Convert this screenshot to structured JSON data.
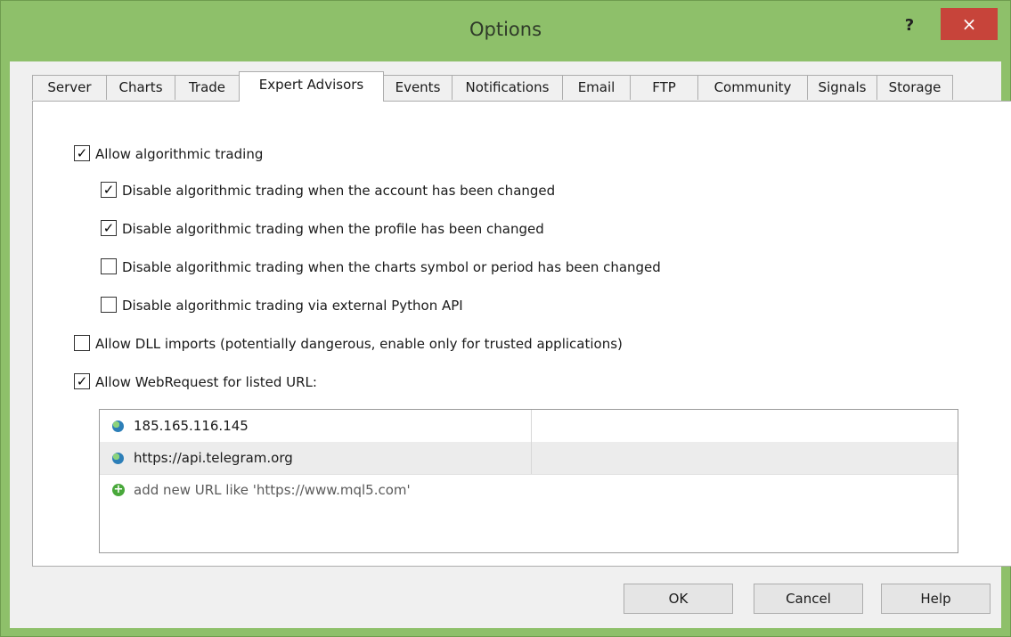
{
  "window": {
    "title": "Options",
    "help_label": "?",
    "close_label": "×"
  },
  "tabs": [
    {
      "label": "Server"
    },
    {
      "label": "Charts"
    },
    {
      "label": "Trade"
    },
    {
      "label": "Expert Advisors",
      "active": true
    },
    {
      "label": "Events"
    },
    {
      "label": "Notifications"
    },
    {
      "label": "Email"
    },
    {
      "label": "FTP"
    },
    {
      "label": "Community"
    },
    {
      "label": "Signals"
    },
    {
      "label": "Storage"
    }
  ],
  "options": [
    {
      "label": "Allow algorithmic trading",
      "checked": true
    },
    {
      "label": "Disable algorithmic trading when the account has been changed",
      "checked": true
    },
    {
      "label": "Disable algorithmic trading when the profile has been changed",
      "checked": true
    },
    {
      "label": "Disable algorithmic trading when the charts symbol or period has been changed",
      "checked": false
    },
    {
      "label": "Disable algorithmic trading via external Python API",
      "checked": false
    },
    {
      "label": "Allow DLL imports (potentially dangerous, enable only for trusted applications)",
      "checked": false
    },
    {
      "label": "Allow WebRequest for listed URL:",
      "checked": true
    }
  ],
  "url_list": {
    "urls": [
      {
        "url": "185.165.116.145",
        "icon": "globe-icon"
      },
      {
        "url": "https://api.telegram.org",
        "icon": "globe-icon"
      }
    ],
    "add_hint": "add new URL like 'https://www.mql5.com'",
    "add_icon": "add-icon"
  },
  "buttons": {
    "ok": "OK",
    "cancel": "Cancel",
    "help": "Help"
  },
  "colors": {
    "frame": "#8ec06a",
    "close": "#c7443a",
    "panel": "#ffffff",
    "selected_row": "#ececec"
  }
}
